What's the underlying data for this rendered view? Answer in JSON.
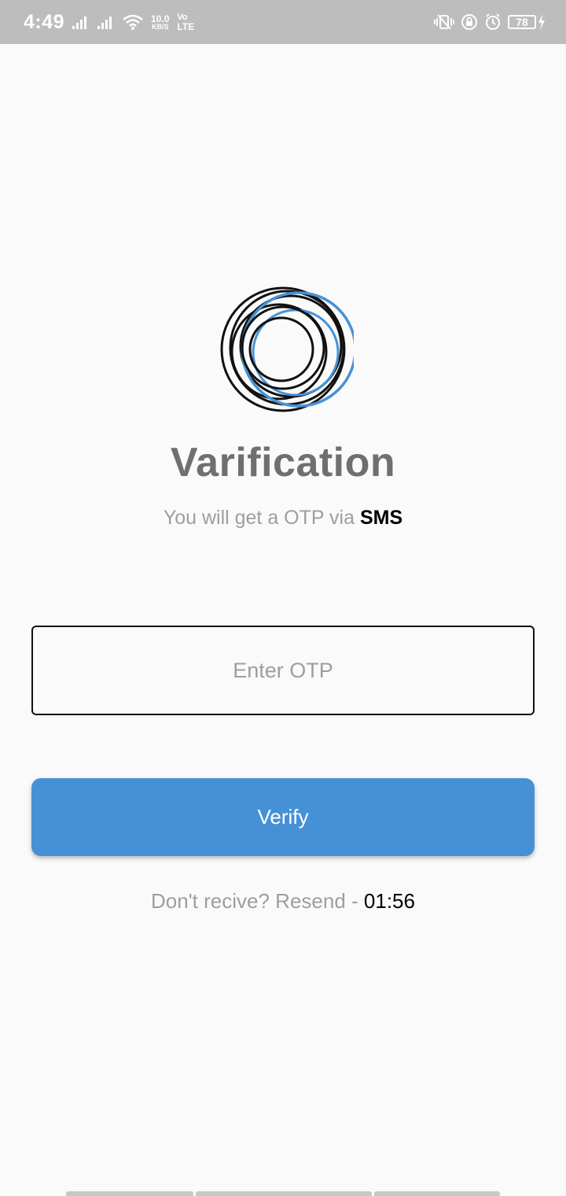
{
  "status_bar": {
    "time": "4:49",
    "speed_value": "10.0",
    "speed_unit": "KB/S",
    "network_vo": "Vo",
    "network_lte": "LTE",
    "battery": "78"
  },
  "screen": {
    "title": "Varification",
    "subtitle_prefix": "You will get a OTP via",
    "subtitle_method": "SMS",
    "otp_placeholder": "Enter OTP",
    "verify_label": "Verify",
    "resend_text": "Don't recive? Resend -",
    "resend_timer": "01:56"
  },
  "colors": {
    "accent": "#4691d6",
    "background": "#fafafa",
    "status_bar": "#bdbdbd"
  },
  "icons": [
    "signal-icon",
    "signal-icon",
    "wifi-icon",
    "vibrate-icon",
    "rotation-lock-icon",
    "alarm-icon",
    "battery-icon",
    "charging-icon"
  ]
}
